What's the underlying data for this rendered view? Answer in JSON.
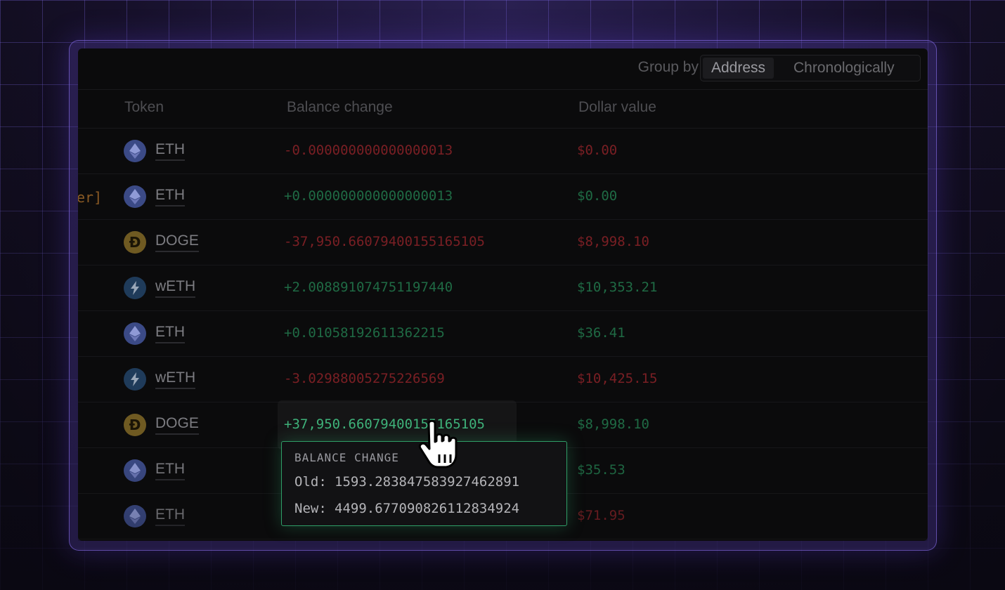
{
  "toolbar": {
    "group_by_label": "Group by",
    "options": [
      "Address",
      "Chronologically"
    ],
    "selected": "Address"
  },
  "columns": [
    "Token",
    "Balance change",
    "Dollar value"
  ],
  "side_fragment": "er]",
  "rows": [
    {
      "token": "ETH",
      "icon": "ethereum-icon",
      "balance_change": "-0.000000000000000013",
      "dollar_value": "$0.00",
      "direction": "negative"
    },
    {
      "token": "ETH",
      "icon": "ethereum-icon",
      "balance_change": "+0.000000000000000013",
      "dollar_value": "$0.00",
      "direction": "positive"
    },
    {
      "token": "DOGE",
      "icon": "dogecoin-icon",
      "balance_change": "-37,950.66079400155165105",
      "dollar_value": "$8,998.10",
      "direction": "negative"
    },
    {
      "token": "wETH",
      "icon": "lightning-icon",
      "balance_change": "+2.008891074751197440",
      "dollar_value": "$10,353.21",
      "direction": "positive"
    },
    {
      "token": "ETH",
      "icon": "ethereum-icon",
      "balance_change": "+0.01058192611362215",
      "dollar_value": "$36.41",
      "direction": "positive"
    },
    {
      "token": "wETH",
      "icon": "lightning-icon",
      "balance_change": "-3.02988005275226569",
      "dollar_value": "$10,425.15",
      "direction": "negative"
    },
    {
      "token": "DOGE",
      "icon": "dogecoin-icon",
      "balance_change": "+37,950.66079400155165105",
      "dollar_value": "$8,998.10",
      "direction": "positive"
    },
    {
      "token": "ETH",
      "icon": "ethereum-icon",
      "balance_change": "",
      "dollar_value": "$35.53",
      "direction": "positive"
    },
    {
      "token": "ETH",
      "icon": "ethereum-icon",
      "balance_change": "",
      "dollar_value": "$71.95",
      "direction": "negative"
    }
  ],
  "tooltip": {
    "title": "BALANCE CHANGE",
    "old_label": "Old:",
    "old_value": "1593.283847583927462891",
    "new_label": "New:",
    "new_value": "4499.677090826112834924"
  },
  "colors": {
    "negative": "#7a1f24",
    "positive": "#1f6a44",
    "tooltip_border": "#2f9e67"
  }
}
